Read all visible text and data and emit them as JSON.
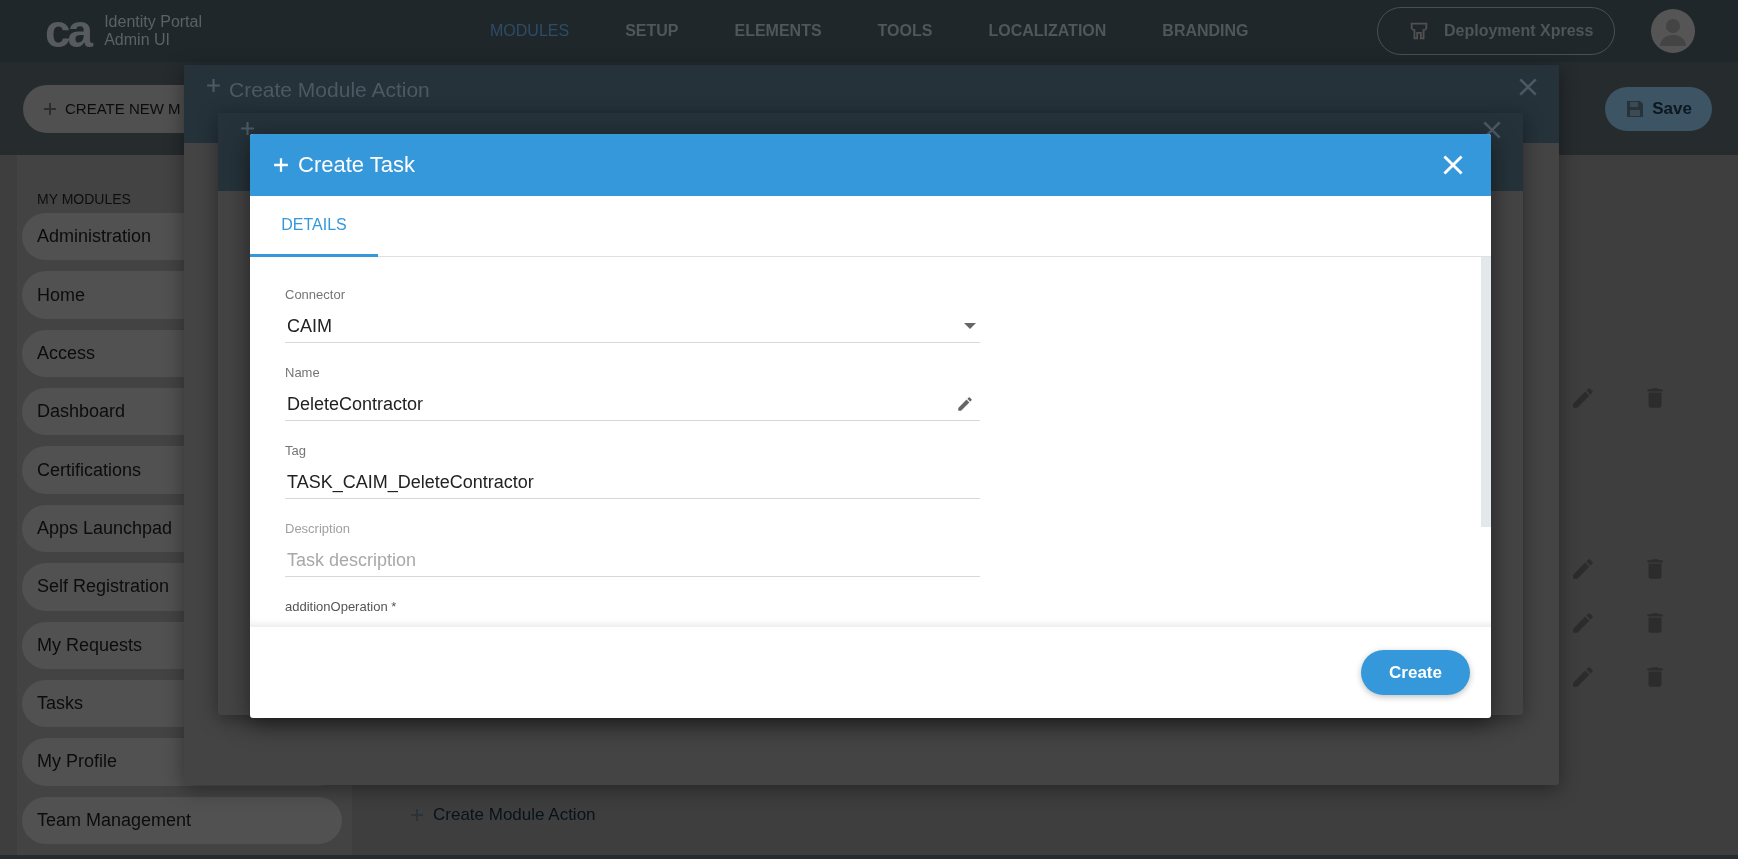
{
  "header": {
    "logo": "ca",
    "product_name": "Identity Portal",
    "product_subtitle": "Admin UI"
  },
  "nav": [
    {
      "label": "MODULES",
      "selected": true
    },
    {
      "label": "SETUP",
      "selected": false
    },
    {
      "label": "ELEMENTS",
      "selected": false
    },
    {
      "label": "TOOLS",
      "selected": false
    },
    {
      "label": "LOCALIZATION",
      "selected": false
    },
    {
      "label": "BRANDING",
      "selected": false
    }
  ],
  "deploy_button": {
    "label": "Deployment Xpress"
  },
  "create_new_button": {
    "label": "CREATE NEW M"
  },
  "save_button": {
    "label": "Save"
  },
  "sidebar": {
    "heading": "MY MODULES",
    "items": [
      "Administration",
      "Home",
      "Access",
      "Dashboard",
      "Certifications",
      "Apps Launchpad",
      "Self Registration",
      "My Requests",
      "Tasks",
      "My Profile",
      "Team Management"
    ]
  },
  "create_module_action_link": "Create Module Action",
  "background_dialog": {
    "title": "Create Module Action"
  },
  "dialog": {
    "title": "Create Task",
    "tabs": [
      {
        "label": "DETAILS",
        "selected": true
      }
    ],
    "fields": [
      {
        "kind": "select",
        "label": "Connector",
        "value": "CAIM"
      },
      {
        "kind": "edit",
        "label": "Name",
        "value": "DeleteContractor"
      },
      {
        "kind": "text",
        "label": "Tag",
        "value": "TASK_CAIM_DeleteContractor"
      },
      {
        "kind": "text",
        "label": "Description",
        "placeholder": "Task description"
      },
      {
        "kind": "heading",
        "label": "additionOperation *"
      }
    ],
    "primary_button": "Create"
  }
}
